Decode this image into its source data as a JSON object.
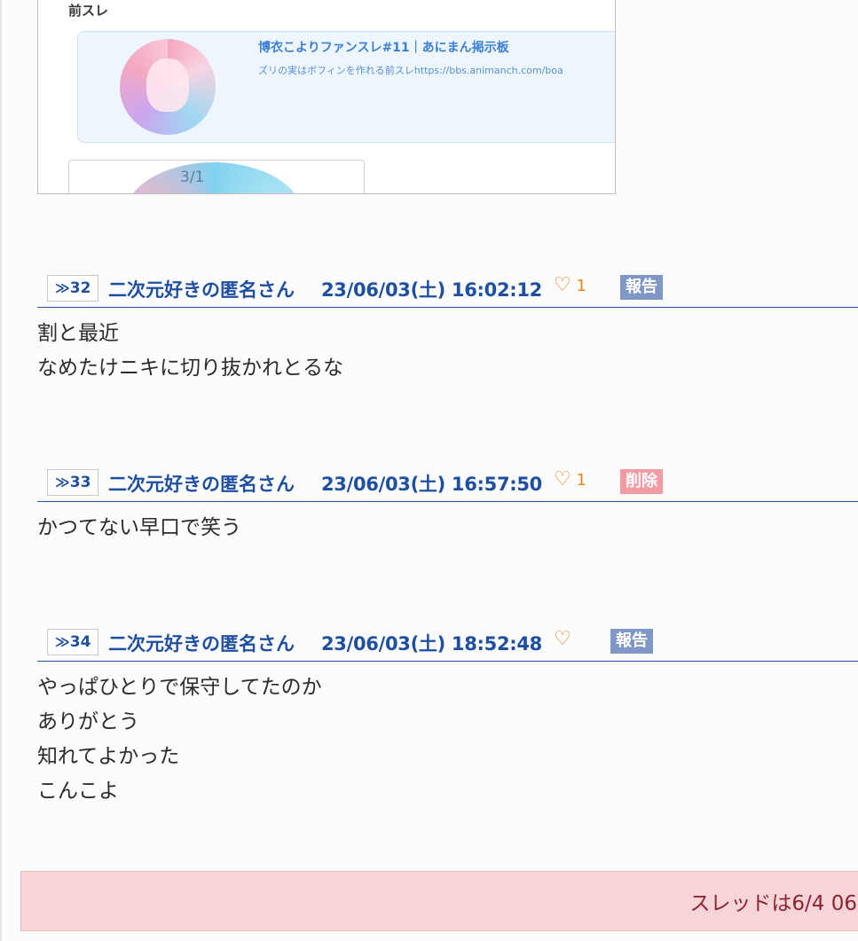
{
  "embed": {
    "label": "前スレ",
    "link_title": "博衣こよりファンスレ#11｜あにまん掲示板",
    "link_desc": "ズリの実はボフィンを作れる前スレhttps://bbs.animanch.com/boa",
    "partial_number": "3/1"
  },
  "posts": [
    {
      "number": "32",
      "author": "二次元好きの匿名さん",
      "datetime": "23/06/03(土) 16:02:12",
      "likes": "1",
      "action": "報告",
      "action_type": "report",
      "lines": [
        "割と最近",
        "なめたけニキに切り抜かれとるな"
      ]
    },
    {
      "number": "33",
      "author": "二次元好きの匿名さん",
      "datetime": "23/06/03(土) 16:57:50",
      "likes": "1",
      "action": "削除",
      "action_type": "delete",
      "lines": [
        "かつてない早口で笑う"
      ]
    },
    {
      "number": "34",
      "author": "二次元好きの匿名さん",
      "datetime": "23/06/03(土) 18:52:48",
      "likes": "",
      "action": "報告",
      "action_type": "report",
      "lines": [
        "やっぱひとりで保守してたのか",
        "ありがとう",
        "知れてよかった",
        "こんこよ"
      ]
    }
  ],
  "notice": {
    "text": "スレッドは6/4 06"
  },
  "icons": {
    "res_arrow": "double-chevron-icon",
    "like": "heart-icon"
  },
  "colors": {
    "link_blue": "#1f4fa0",
    "like_orange": "#e8851a",
    "report_bg": "#7f98c8",
    "delete_bg": "#f39aa4",
    "notice_bg": "#f6d4d8"
  }
}
